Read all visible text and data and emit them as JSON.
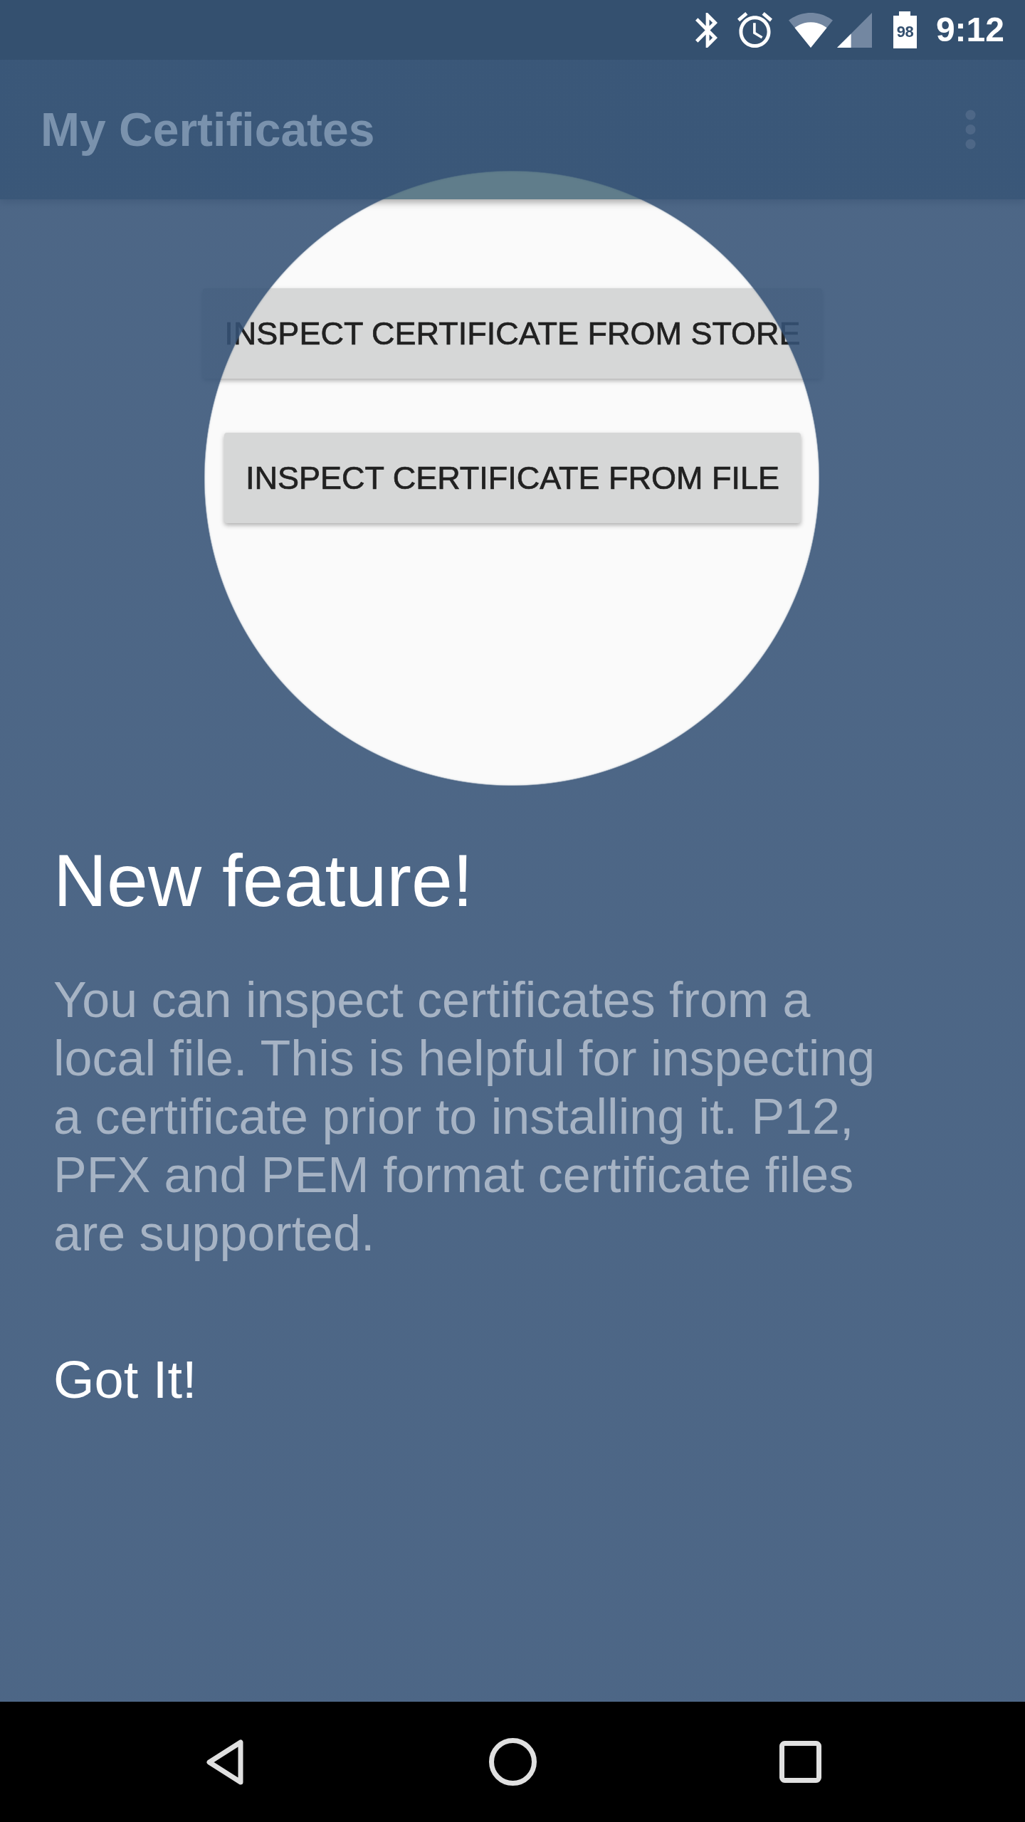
{
  "status_bar": {
    "battery": "98",
    "time": "9:12"
  },
  "app_bar": {
    "title": "My Certificates"
  },
  "buttons": [
    {
      "label": "INSPECT CERTIFICATE FROM STORE"
    },
    {
      "label": "INSPECT CERTIFICATE FROM FILE"
    }
  ],
  "feature_prompt": {
    "title": "New feature!",
    "description": "You can inspect certificates from a local file. This is helpful for inspecting a certificate prior to installing it. P12, PFX and PEM format certificate files are supported.",
    "dismiss": "Got It!"
  }
}
